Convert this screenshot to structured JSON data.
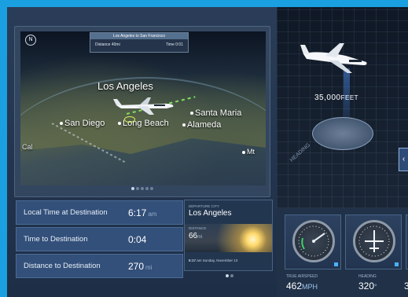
{
  "map": {
    "compass_icon": "compass-icon",
    "trip_route": "Los Angeles to San Francisco",
    "distance_label": "Distance",
    "distance_value": "40mi",
    "time_label": "Time",
    "time_value": "0:01",
    "cities": [
      "Los Angeles",
      "San Diego",
      "Long Beach",
      "Santa Maria",
      "Alameda",
      "Mt",
      "Cal"
    ],
    "pager": {
      "count": 5,
      "active": 1
    }
  },
  "info": [
    {
      "label": "Local Time at Destination",
      "value": "6:17",
      "unit": "am"
    },
    {
      "label": "Time to Destination",
      "value": "0:04",
      "unit": ""
    },
    {
      "label": "Distance to Destination",
      "value": "270",
      "unit": "mi"
    }
  ],
  "departure": {
    "city_label": "DEPARTURE CITY",
    "city": "Los Angeles",
    "distance_label": "DISTANCE",
    "distance_value": "66",
    "distance_unit": "mi",
    "time_value": "6:17",
    "time_text": "am Sunday, November 13"
  },
  "flight3d": {
    "altitude": "35,000",
    "altitude_unit": "FEET",
    "heading_label": "HEADING",
    "side_tab": "‹"
  },
  "gauges": [
    {
      "label": "TRUE AIRSPEED",
      "value": "462",
      "unit": "MPH"
    },
    {
      "label": "HEADING",
      "value": "320",
      "unit": "°"
    },
    {
      "label": "",
      "value": "3",
      "unit": ""
    }
  ],
  "bottom_pager": {
    "count": 2,
    "active": 0
  },
  "colors": {
    "accent_blue": "#47b3ff",
    "route_green": "#7fe05a",
    "frame": "#1a9fe0"
  }
}
